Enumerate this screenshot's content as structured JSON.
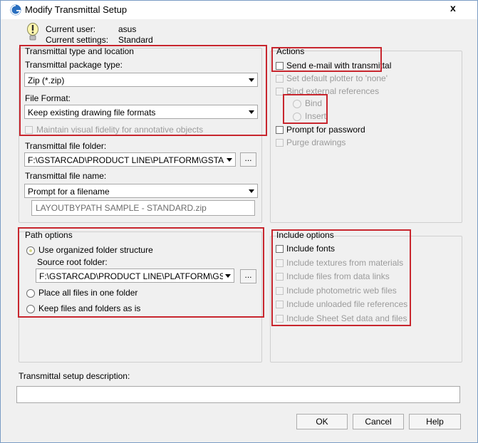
{
  "window": {
    "title": "Modify Transmittal Setup",
    "close_glyph": "x"
  },
  "header": {
    "current_user_label": "Current user:",
    "current_user": "asus",
    "current_settings_label": "Current settings:",
    "current_settings": "Standard"
  },
  "type_location": {
    "legend": "Transmittal type and location",
    "package_type_label": "Transmittal package type:",
    "package_type_value": "Zip (*.zip)",
    "file_format_label": "File Format:",
    "file_format_value": "Keep existing drawing file formats",
    "maintain_fidelity_label": "Maintain visual fidelity for annotative objects",
    "file_folder_label": "Transmittal file folder:",
    "file_folder_value": "F:\\GSTARCAD\\PRODUCT LINE\\PLATFORM\\GSTARCA",
    "browse_label": "...",
    "file_name_label": "Transmittal file name:",
    "file_name_value": "Prompt for a filename",
    "file_name_preview": "LAYOUTBYPATH SAMPLE - STANDARD.zip"
  },
  "path_options": {
    "legend": "Path options",
    "organized_label": "Use organized folder structure",
    "source_root_label": "Source root folder:",
    "source_root_value": "F:\\GSTARCAD\\PRODUCT LINE\\PLATFORM\\GSTAR",
    "browse_label": "...",
    "one_folder_label": "Place all files in one folder",
    "keep_as_is_label": "Keep files and folders as is"
  },
  "actions": {
    "legend": "Actions",
    "send_email_label": "Send e-mail with transmittal",
    "default_plotter_label": "Set default plotter to 'none'",
    "bind_xrefs_label": "Bind external references",
    "bind_label": "Bind",
    "insert_label": "Insert",
    "prompt_password_label": "Prompt for password",
    "purge_label": "Purge drawings"
  },
  "include_options": {
    "legend": "Include options",
    "fonts_label": "Include fonts",
    "textures_label": "Include textures from materials",
    "data_links_label": "Include files from data links",
    "photometric_label": "Include photometric web files",
    "unloaded_label": "Include unloaded file references",
    "sheet_set_label": "Include Sheet Set data and files"
  },
  "description": {
    "label": "Transmittal setup description:",
    "value": ""
  },
  "buttons": {
    "ok": "OK",
    "cancel": "Cancel",
    "help": "Help"
  },
  "colors": {
    "highlight": "#c8262e",
    "window_bg": "#f0f0f0",
    "disabled_text": "#9b9b9b"
  }
}
